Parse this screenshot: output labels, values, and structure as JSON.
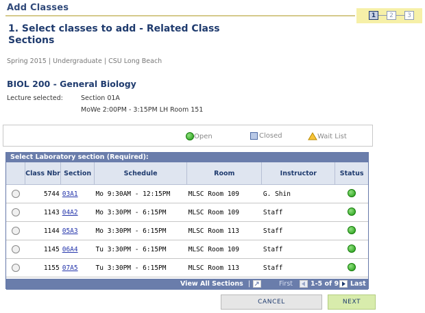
{
  "page": {
    "title": "Add Classes",
    "heading": "1.  Select classes to add - Related Class Sections",
    "term": "Spring 2015 | Undergraduate | CSU Long Beach"
  },
  "steps": [
    "1",
    "2",
    "3"
  ],
  "course": {
    "title": "BIOL  200 - General Biology",
    "lecture_label": "Lecture selected:",
    "lecture_section": "Section 01A",
    "lecture_time": "MoWe 2:00PM - 3:15PM  LH  Room 151"
  },
  "legend": {
    "open": "Open",
    "closed": "Closed",
    "waitlist": "Wait List"
  },
  "grid": {
    "caption": "Select Laboratory section (Required):",
    "columns": [
      "Class Nbr",
      "Section",
      "Schedule",
      "Room",
      "Instructor",
      "Status"
    ],
    "rows": [
      {
        "nbr": "5744",
        "section": "03A1",
        "schedule": "Mo 9:30AM - 12:15PM",
        "room": "MLSC Room 109",
        "instructor": "G. Shin",
        "status": "Open"
      },
      {
        "nbr": "1143",
        "section": "04A2",
        "schedule": "Mo 3:30PM - 6:15PM",
        "room": "MLSC Room 109",
        "instructor": "Staff",
        "status": "Open"
      },
      {
        "nbr": "1144",
        "section": "05A3",
        "schedule": "Mo 3:30PM - 6:15PM",
        "room": "MLSC Room 113",
        "instructor": "Staff",
        "status": "Open"
      },
      {
        "nbr": "1145",
        "section": "06A4",
        "schedule": "Tu 3:30PM - 6:15PM",
        "room": "MLSC Room 109",
        "instructor": "Staff",
        "status": "Open"
      },
      {
        "nbr": "1155",
        "section": "07A5",
        "schedule": "Tu 3:30PM - 6:15PM",
        "room": "MLSC Room 113",
        "instructor": "Staff",
        "status": "Open"
      }
    ],
    "footer": {
      "view_all": "View All Sections",
      "first": "First",
      "range": "1-5 of 9",
      "last": "Last"
    }
  },
  "buttons": {
    "cancel": "CANCEL",
    "next": "NEXT"
  },
  "colors": {
    "header_blue": "#1f3b6e",
    "grid_header": "#6a7dab",
    "open_green": "#1f9a12",
    "next_green": "#d8ecac"
  }
}
